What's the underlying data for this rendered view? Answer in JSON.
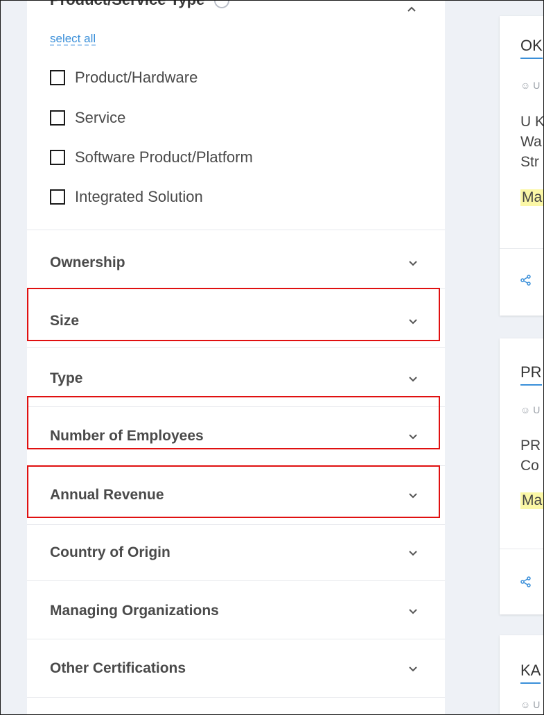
{
  "filter_panel": {
    "section_title": "Product/Service Type",
    "select_all_label": "select all",
    "checkbox_options": [
      {
        "label": "Product/Hardware",
        "checked": false
      },
      {
        "label": "Service",
        "checked": false
      },
      {
        "label": "Software Product/Platform",
        "checked": false
      },
      {
        "label": "Integrated Solution",
        "checked": false
      }
    ],
    "accordions": [
      {
        "label": "Ownership"
      },
      {
        "label": "Size",
        "highlighted": true
      },
      {
        "label": "Type"
      },
      {
        "label": "Number of Employees",
        "highlighted": true
      },
      {
        "label": "Annual Revenue",
        "highlighted": true
      },
      {
        "label": "Country of Origin"
      },
      {
        "label": "Managing Organizations"
      },
      {
        "label": "Other Certifications"
      }
    ]
  },
  "results": {
    "cards": [
      {
        "title": "OK",
        "owner": "U",
        "desc": [
          "U K",
          "Wa",
          "Str"
        ],
        "tag": "Ma"
      },
      {
        "title": "PR",
        "owner": "U",
        "desc": [
          "PR",
          "Co"
        ],
        "tag": "Ma"
      },
      {
        "title": "KA",
        "owner": "U"
      }
    ]
  },
  "colors": {
    "link": "#3a8fd9",
    "highlight_border": "#e01010",
    "tag_background": "#fbf7a6",
    "page_background": "#eef1f6"
  }
}
